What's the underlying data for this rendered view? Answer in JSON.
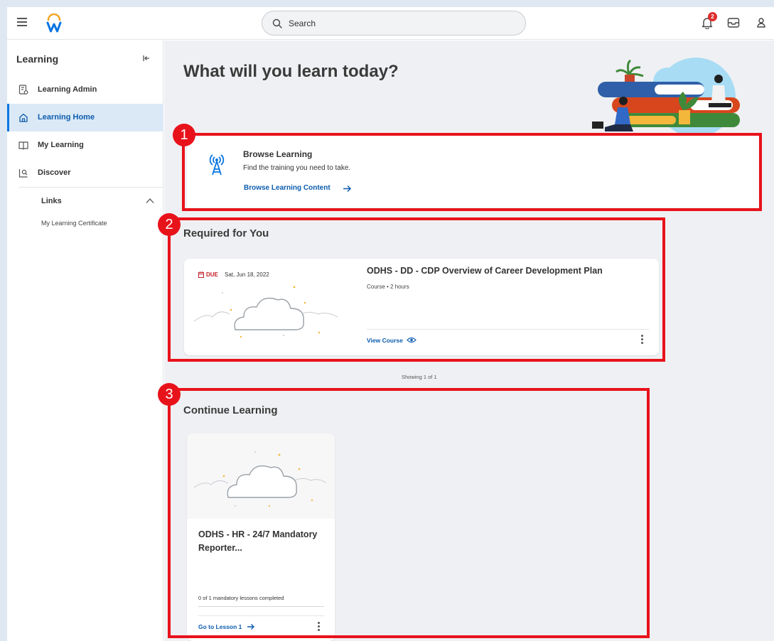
{
  "topbar": {
    "search_placeholder": "Search",
    "notification_count": "2",
    "icons": [
      "menu-icon",
      "workday-logo",
      "search-icon",
      "bell-icon",
      "inbox-icon",
      "profile-icon"
    ]
  },
  "sidebar": {
    "title": "Learning",
    "items": [
      {
        "label": "Learning Admin",
        "icon": "learning-admin-icon",
        "active": false
      },
      {
        "label": "Learning Home",
        "icon": "home-icon",
        "active": true
      },
      {
        "label": "My Learning",
        "icon": "book-icon",
        "active": false
      },
      {
        "label": "Discover",
        "icon": "discover-icon",
        "active": false
      }
    ],
    "links_title": "Links",
    "links": [
      "My Learning Certificate"
    ]
  },
  "main": {
    "page_title": "What will you learn today?",
    "browse": {
      "title": "Browse Learning",
      "description": "Find the training you need to take.",
      "link": "Browse Learning Content"
    },
    "required": {
      "section_title": "Required for You",
      "card": {
        "due_label": "DUE",
        "due_date": "Sat, Jun 18, 2022",
        "title": "ODHS - DD - CDP Overview of Career Development Plan",
        "meta": "Course • 2 hours",
        "action": "View Course"
      },
      "showing": "Showing 1 of 1"
    },
    "continue": {
      "section_title": "Continue Learning",
      "card": {
        "title": "ODHS - HR - 24/7 Mandatory Reporter...",
        "progress": "0 of 1 mandatory lessons completed",
        "action": "Go to Lesson 1"
      }
    }
  },
  "callouts": [
    "1",
    "2",
    "3"
  ],
  "colors": {
    "accent": "#0875e1",
    "link": "#0b5cad",
    "active_bg": "#dbe9f6",
    "callout": "#e8121b",
    "due": "#c4202a",
    "main_bg": "#eff0f3"
  }
}
